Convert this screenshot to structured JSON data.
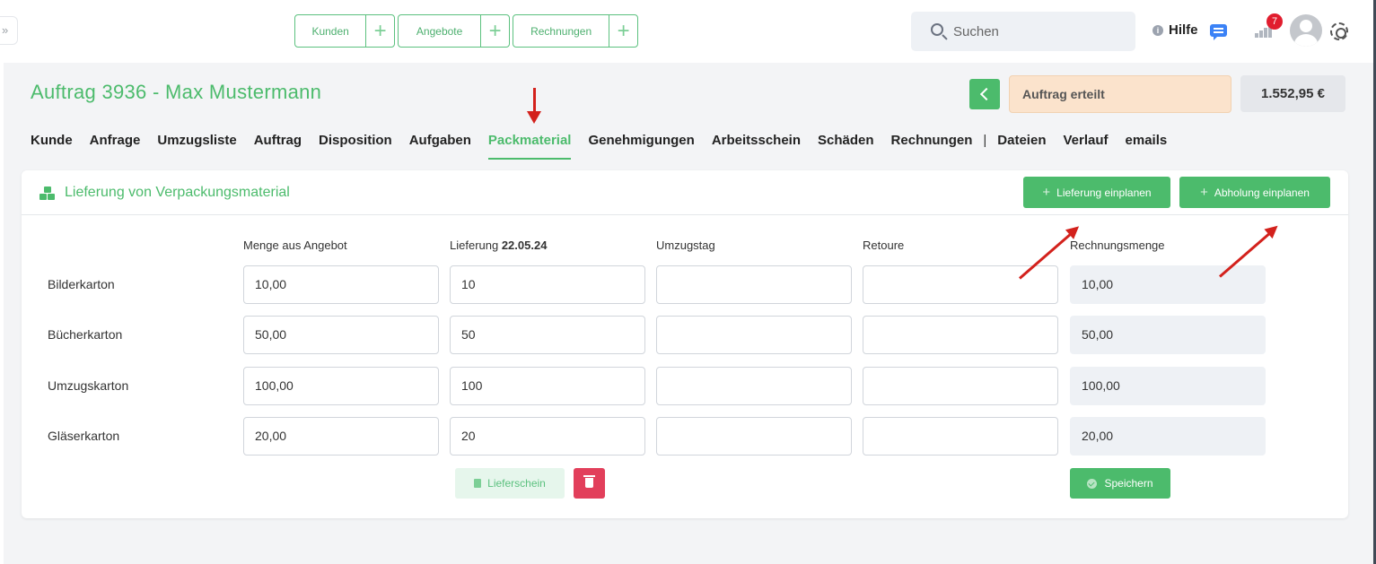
{
  "topbar": {
    "quick_actions": [
      {
        "label": "Kunden"
      },
      {
        "label": "Angebote"
      },
      {
        "label": "Rechnungen"
      }
    ],
    "search_placeholder": "Suchen",
    "help_label": "Hilfe",
    "notification_count": "7"
  },
  "header": {
    "title": "Auftrag 3936 - Max Mustermann",
    "status": "Auftrag erteilt",
    "total": "1.552,95 €"
  },
  "tabs": [
    {
      "label": "Kunde"
    },
    {
      "label": "Anfrage"
    },
    {
      "label": "Umzugsliste"
    },
    {
      "label": "Auftrag"
    },
    {
      "label": "Disposition"
    },
    {
      "label": "Aufgaben"
    },
    {
      "label": "Packmaterial",
      "active": true
    },
    {
      "label": "Genehmigungen"
    },
    {
      "label": "Arbeitsschein"
    },
    {
      "label": "Schäden"
    },
    {
      "label": "Rechnungen"
    },
    {
      "label": "Dateien"
    },
    {
      "label": "Verlauf"
    },
    {
      "label": "emails"
    }
  ],
  "tab_separator": "|",
  "card": {
    "title": "Lieferung von Verpackungsmaterial",
    "btn_delivery": "Lieferung einplanen",
    "btn_pickup": "Abholung einplanen",
    "columns": {
      "menge": "Menge aus Angebot",
      "lieferung_prefix": "Lieferung ",
      "lieferung_date": "22.05.24",
      "umzugstag": "Umzugstag",
      "retoure": "Retoure",
      "rechnungsmenge": "Rechnungsmenge"
    },
    "rows": [
      {
        "label": "Bilderkarton",
        "menge": "10,00",
        "lieferung": "10",
        "umzugstag": "",
        "retoure": "",
        "rechnungsmenge": "10,00"
      },
      {
        "label": "Bücherkarton",
        "menge": "50,00",
        "lieferung": "50",
        "umzugstag": "",
        "retoure": "",
        "rechnungsmenge": "50,00"
      },
      {
        "label": "Umzugskarton",
        "menge": "100,00",
        "lieferung": "100",
        "umzugstag": "",
        "retoure": "",
        "rechnungsmenge": "100,00"
      },
      {
        "label": "Gläserkarton",
        "menge": "20,00",
        "lieferung": "20",
        "umzugstag": "",
        "retoure": "",
        "rechnungsmenge": "20,00"
      }
    ],
    "btn_lieferschein": "Lieferschein",
    "btn_save": "Speichern"
  },
  "colors": {
    "accent": "#4cbb6c",
    "danger": "#e23f5b",
    "status_bg": "#fbe3cc",
    "annotation_arrow": "#d3211c"
  }
}
